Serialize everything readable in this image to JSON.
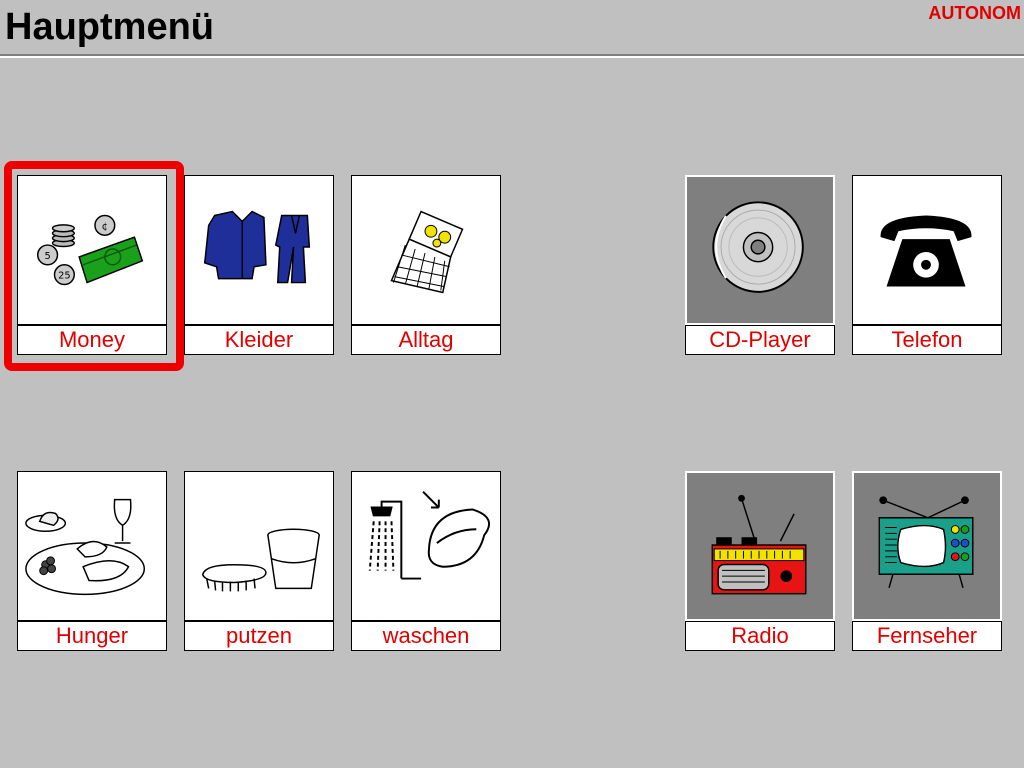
{
  "header": {
    "title": "Hauptmenü",
    "mode": "AUTONOM"
  },
  "colors": {
    "label": "#e00000",
    "highlight": "#ee0000",
    "background": "#c0c0c0"
  },
  "selected": "money",
  "tiles": [
    {
      "label": "Money",
      "icon": "money-icon"
    },
    {
      "label": "Kleider",
      "icon": "clothes-icon"
    },
    {
      "label": "Alltag",
      "icon": "calendar-icon"
    },
    {
      "label": "CD-Player",
      "icon": "cd-icon"
    },
    {
      "label": "Telefon",
      "icon": "telephone-icon"
    },
    {
      "label": "Hunger",
      "icon": "meal-icon"
    },
    {
      "label": "putzen",
      "icon": "cleaning-icon"
    },
    {
      "label": "waschen",
      "icon": "shower-icon"
    },
    {
      "label": "Radio",
      "icon": "radio-icon"
    },
    {
      "label": "Fernseher",
      "icon": "tv-icon"
    }
  ]
}
